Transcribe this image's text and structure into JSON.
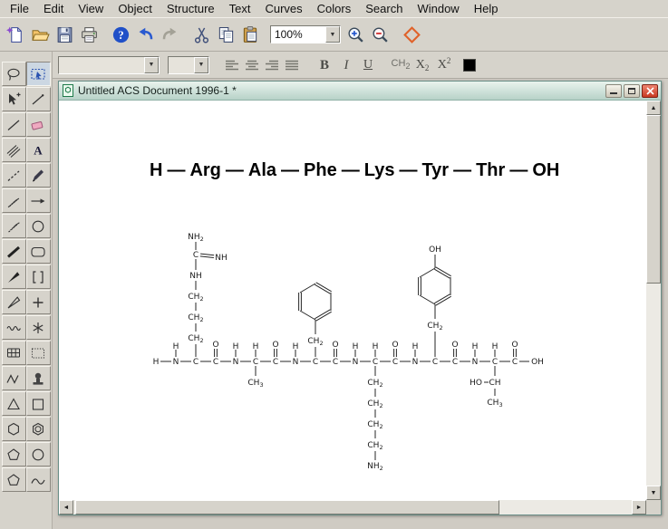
{
  "colors": {
    "chrome": "#d6d3cb",
    "canvas": "#ffffff",
    "titlebar_start": "#e9f3ed",
    "titlebar_end": "#b7d2c8",
    "close_button": "#c83a22",
    "selection_blue": "#2a52b0",
    "structure_ink": "#262626"
  },
  "glyphs": {
    "arrow_up": "▲",
    "arrow_down": "▼",
    "arrow_left": "◄",
    "arrow_right": "►",
    "dropdown": "▼"
  },
  "menu": {
    "items": [
      "File",
      "Edit",
      "View",
      "Object",
      "Structure",
      "Text",
      "Curves",
      "Colors",
      "Search",
      "Window",
      "Help"
    ]
  },
  "toolbar_main": {
    "zoom_value": "100%",
    "icons_left": [
      {
        "name": "new-document-button",
        "icon": "new-doc"
      },
      {
        "name": "open-button",
        "icon": "open-folder"
      },
      {
        "name": "save-button",
        "icon": "save"
      },
      {
        "name": "print-button",
        "icon": "print"
      },
      {
        "sep": true
      },
      {
        "name": "help-button",
        "icon": "help"
      },
      {
        "name": "undo-button",
        "icon": "undo"
      },
      {
        "name": "redo-button",
        "icon": "redo"
      },
      {
        "sep": true
      },
      {
        "name": "cut-button",
        "icon": "cut"
      },
      {
        "name": "copy-button",
        "icon": "copy"
      },
      {
        "name": "paste-button",
        "icon": "paste"
      }
    ],
    "icons_right": [
      {
        "name": "zoom-in-button",
        "icon": "zoom-in"
      },
      {
        "name": "zoom-out-button",
        "icon": "zoom-out"
      },
      {
        "sep": true
      },
      {
        "name": "shape-diamond-button",
        "icon": "diamond"
      }
    ]
  },
  "toolbar_format": {
    "font_value": "",
    "size_value": "",
    "align": [
      {
        "name": "align-left-button",
        "icon": "align-left"
      },
      {
        "name": "align-center-button",
        "icon": "align-center"
      },
      {
        "name": "align-right-button",
        "icon": "align-right"
      },
      {
        "name": "align-justify-button",
        "icon": "align-justify"
      }
    ],
    "bold": "B",
    "italic": "I",
    "underline": "U",
    "formula_base": "CH",
    "formula_sub": "2",
    "subscript_base": "X",
    "subscript_sub": "2",
    "superscript_base": "X",
    "superscript_sup": "2"
  },
  "tool_palette": {
    "tools": [
      {
        "name": "lasso-tool",
        "icon": "lasso"
      },
      {
        "name": "marquee-tool",
        "icon": "marquee",
        "selected": true
      },
      {
        "name": "move-tool",
        "icon": "arrow-plus"
      },
      {
        "name": "bond-tool",
        "icon": "bond"
      },
      {
        "name": "single-bond-tool",
        "icon": "line"
      },
      {
        "name": "eraser-tool",
        "icon": "eraser"
      },
      {
        "name": "multiple-bond-tool",
        "icon": "multi-line"
      },
      {
        "name": "text-tool",
        "icon": "letter-a"
      },
      {
        "name": "dashed-bond-tool",
        "icon": "dashed"
      },
      {
        "name": "pen-tool",
        "icon": "pen"
      },
      {
        "name": "hashed-bond-tool",
        "icon": "hash"
      },
      {
        "name": "arrow-tool",
        "icon": "arrow"
      },
      {
        "name": "hashed-wedge-tool",
        "icon": "hash-wedge"
      },
      {
        "name": "orbital-tool",
        "icon": "circle"
      },
      {
        "name": "bold-bond-tool",
        "icon": "bold-line"
      },
      {
        "name": "rounded-rect-tool",
        "icon": "rounded-rect"
      },
      {
        "name": "wedge-bond-tool",
        "icon": "wedge"
      },
      {
        "name": "bracket-tool",
        "icon": "bracket"
      },
      {
        "name": "hollow-wedge-tool",
        "icon": "hollow-wedge"
      },
      {
        "name": "plus-tool",
        "icon": "plus"
      },
      {
        "name": "wavy-bond-tool",
        "icon": "wavy"
      },
      {
        "name": "asterisk-tool",
        "icon": "asterisk"
      },
      {
        "name": "table-tool",
        "icon": "grid"
      },
      {
        "name": "selection-rect-tool",
        "icon": "dotted-rect"
      },
      {
        "name": "chain-tool",
        "icon": "zigzag"
      },
      {
        "name": "template-tool",
        "icon": "stamp"
      },
      {
        "name": "triangle-tool",
        "icon": "triangle"
      },
      {
        "name": "square-tool",
        "icon": "square"
      },
      {
        "name": "cyclohexane-tool",
        "icon": "hexagon"
      },
      {
        "name": "benzene-tool",
        "icon": "benzene"
      },
      {
        "name": "cyclopentane-tool",
        "icon": "pentagon"
      },
      {
        "name": "circle-tool",
        "icon": "circle"
      },
      {
        "name": "cyclopentadiene-tool",
        "icon": "pentagon"
      },
      {
        "name": "curve-tool",
        "icon": "curves"
      }
    ]
  },
  "mdi": {
    "title": "Untitled ACS Document 1996-1 *"
  },
  "document": {
    "sequence": [
      "H",
      "Arg",
      "Ala",
      "Phe",
      "Lys",
      "Tyr",
      "Thr",
      "OH"
    ],
    "separator": "—"
  },
  "structure": {
    "atoms": [
      [
        "H",
        93,
        288,
        5
      ],
      [
        "N",
        115,
        288,
        5
      ],
      [
        "H",
        115,
        271,
        4
      ],
      [
        "C",
        137,
        288,
        5
      ],
      [
        "C",
        159,
        288,
        5
      ],
      [
        "O",
        159,
        269,
        5
      ],
      [
        "N",
        181,
        288,
        5
      ],
      [
        "H",
        181,
        271,
        4
      ],
      [
        "C",
        203,
        288,
        5
      ],
      [
        "H",
        203,
        271,
        4
      ],
      [
        "C",
        225,
        288,
        5
      ],
      [
        "O",
        225,
        269,
        5
      ],
      [
        "N",
        247,
        288,
        5
      ],
      [
        "H",
        247,
        271,
        4
      ],
      [
        "C",
        269,
        288,
        5
      ],
      [
        "C",
        291,
        288,
        5
      ],
      [
        "O",
        291,
        269,
        5
      ],
      [
        "N",
        313,
        288,
        5
      ],
      [
        "H",
        313,
        271,
        4
      ],
      [
        "C",
        335,
        288,
        5
      ],
      [
        "H",
        335,
        271,
        4
      ],
      [
        "C",
        357,
        288,
        5
      ],
      [
        "O",
        357,
        269,
        5
      ],
      [
        "N",
        379,
        288,
        5
      ],
      [
        "H",
        379,
        271,
        4
      ],
      [
        "C",
        401,
        288,
        5
      ],
      [
        "C",
        423,
        288,
        5
      ],
      [
        "O",
        423,
        269,
        5
      ],
      [
        "N",
        445,
        288,
        5
      ],
      [
        "H",
        445,
        271,
        4
      ],
      [
        "C",
        467,
        288,
        5
      ],
      [
        "H",
        467,
        271,
        4
      ],
      [
        "C",
        489,
        288,
        5
      ],
      [
        "O",
        489,
        269,
        5
      ],
      [
        "OH",
        514,
        288,
        9
      ],
      [
        "CH2",
        137,
        262,
        7
      ],
      [
        "CH2",
        137,
        239,
        7
      ],
      [
        "CH2",
        137,
        216,
        7
      ],
      [
        "NH",
        137,
        193,
        6
      ],
      [
        "C",
        137,
        170,
        5
      ],
      [
        "NH2",
        137,
        150,
        6
      ],
      [
        "NH",
        165,
        173,
        8
      ],
      [
        "CH3",
        203,
        311,
        7
      ],
      [
        null,
        269,
        242,
        0
      ],
      [
        null,
        252,
        232,
        0
      ],
      [
        null,
        252,
        212,
        0
      ],
      [
        null,
        269,
        202,
        0
      ],
      [
        null,
        286,
        212,
        0
      ],
      [
        null,
        286,
        232,
        0
      ],
      [
        "CH2",
        269,
        265,
        7
      ],
      [
        "CH2",
        335,
        311,
        7
      ],
      [
        "CH2",
        335,
        334,
        7
      ],
      [
        "CH2",
        335,
        357,
        7
      ],
      [
        "CH2",
        335,
        380,
        7
      ],
      [
        "NH2",
        335,
        403,
        6
      ],
      [
        "OH",
        401,
        164,
        6
      ],
      [
        null,
        401,
        185,
        0
      ],
      [
        null,
        384,
        195,
        0
      ],
      [
        null,
        384,
        215,
        0
      ],
      [
        null,
        401,
        225,
        0
      ],
      [
        null,
        418,
        215,
        0
      ],
      [
        null,
        418,
        195,
        0
      ],
      [
        "CH2",
        401,
        248,
        7
      ],
      [
        "CH",
        467,
        311,
        7
      ],
      [
        "HO",
        446,
        311,
        9
      ],
      [
        "CH3",
        467,
        333,
        7
      ]
    ],
    "bonds": [
      [
        0,
        1,
        1
      ],
      [
        1,
        2,
        1
      ],
      [
        1,
        3,
        1
      ],
      [
        3,
        4,
        1
      ],
      [
        4,
        5,
        2
      ],
      [
        4,
        6,
        1
      ],
      [
        6,
        7,
        1
      ],
      [
        6,
        8,
        1
      ],
      [
        8,
        9,
        1
      ],
      [
        8,
        10,
        1
      ],
      [
        10,
        11,
        2
      ],
      [
        10,
        12,
        1
      ],
      [
        12,
        13,
        1
      ],
      [
        12,
        14,
        1
      ],
      [
        14,
        15,
        1
      ],
      [
        15,
        16,
        2
      ],
      [
        15,
        17,
        1
      ],
      [
        17,
        18,
        1
      ],
      [
        17,
        19,
        1
      ],
      [
        19,
        20,
        1
      ],
      [
        19,
        21,
        1
      ],
      [
        21,
        22,
        2
      ],
      [
        21,
        23,
        1
      ],
      [
        23,
        24,
        1
      ],
      [
        23,
        25,
        1
      ],
      [
        25,
        26,
        1
      ],
      [
        26,
        27,
        2
      ],
      [
        26,
        28,
        1
      ],
      [
        28,
        29,
        1
      ],
      [
        28,
        30,
        1
      ],
      [
        30,
        31,
        1
      ],
      [
        30,
        32,
        1
      ],
      [
        32,
        33,
        2
      ],
      [
        32,
        34,
        1
      ],
      [
        3,
        35,
        1
      ],
      [
        35,
        36,
        1
      ],
      [
        36,
        37,
        1
      ],
      [
        37,
        38,
        1
      ],
      [
        38,
        39,
        1
      ],
      [
        39,
        40,
        1
      ],
      [
        39,
        41,
        2
      ],
      [
        8,
        42,
        1
      ],
      [
        14,
        49,
        1
      ],
      [
        49,
        43,
        1
      ],
      [
        43,
        44,
        1
      ],
      [
        44,
        45,
        2
      ],
      [
        45,
        46,
        1
      ],
      [
        46,
        47,
        2
      ],
      [
        47,
        48,
        1
      ],
      [
        48,
        43,
        2
      ],
      [
        19,
        50,
        1
      ],
      [
        50,
        51,
        1
      ],
      [
        51,
        52,
        1
      ],
      [
        52,
        53,
        1
      ],
      [
        53,
        54,
        1
      ],
      [
        25,
        62,
        1
      ],
      [
        62,
        59,
        1
      ],
      [
        59,
        58,
        1
      ],
      [
        58,
        57,
        2
      ],
      [
        57,
        56,
        1
      ],
      [
        56,
        61,
        2
      ],
      [
        61,
        60,
        1
      ],
      [
        60,
        59,
        2
      ],
      [
        56,
        55,
        1
      ],
      [
        30,
        63,
        1
      ],
      [
        63,
        64,
        1
      ],
      [
        63,
        65,
        1
      ]
    ]
  }
}
